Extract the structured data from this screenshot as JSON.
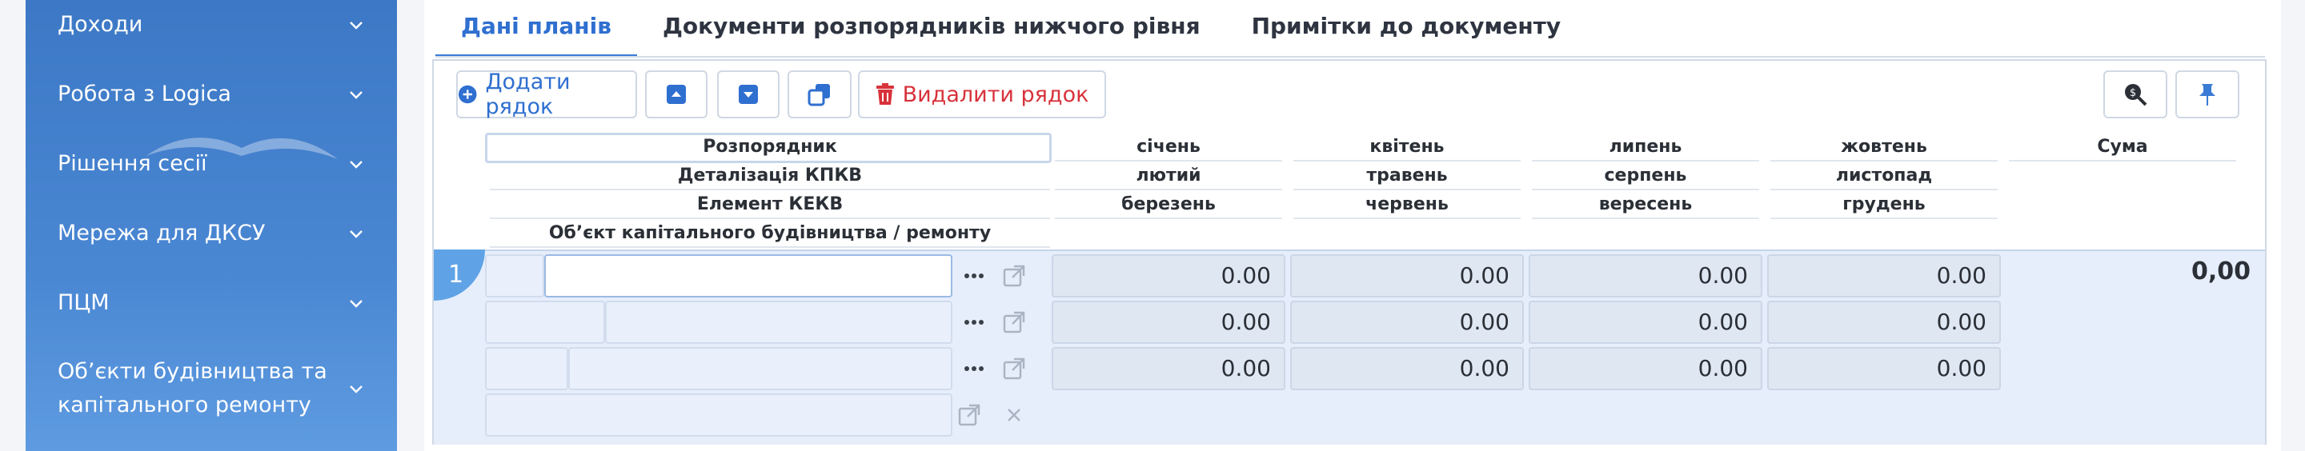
{
  "sidebar": {
    "items": [
      {
        "label": "Доходи"
      },
      {
        "label": "Робота з Logica"
      },
      {
        "label": "Рішення сесії"
      },
      {
        "label": "Мережа для ДКСУ"
      },
      {
        "label": "ПЦМ"
      },
      {
        "label_line1": "Об’єкти будівництва та",
        "label_line2": "капітального ремонту"
      }
    ]
  },
  "tabs": [
    {
      "label": "Дані планів",
      "active": true
    },
    {
      "label": "Документи розпорядників нижчого рівня",
      "active": false
    },
    {
      "label": "Примітки до документу",
      "active": false
    }
  ],
  "toolbar": {
    "add_label": "Додати рядок",
    "delete_label": "Видалити рядок"
  },
  "grid": {
    "left_headers": [
      "Розпорядник",
      "Деталізація КПКВ",
      "Елемент КЕКВ",
      "Об’єкт капітального будівництва / ремонту"
    ],
    "month_headers": [
      [
        "січень",
        "квітень",
        "липень",
        "жовтень",
        "Сума"
      ],
      [
        "лютий",
        "травень",
        "серпень",
        "листопад"
      ],
      [
        "березень",
        "червень",
        "вересень",
        "грудень"
      ]
    ],
    "row": {
      "number": "1",
      "values": [
        [
          "0.00",
          "0.00",
          "0.00",
          "0.00"
        ],
        [
          "0.00",
          "0.00",
          "0.00",
          "0.00"
        ],
        [
          "0.00",
          "0.00",
          "0.00",
          "0.00"
        ]
      ],
      "sum": "0,00"
    }
  },
  "colors": {
    "sidebar": "#4a87d3",
    "accent": "#2f6fd0",
    "danger": "#d8323b",
    "row_bg": "#e6eefb"
  }
}
